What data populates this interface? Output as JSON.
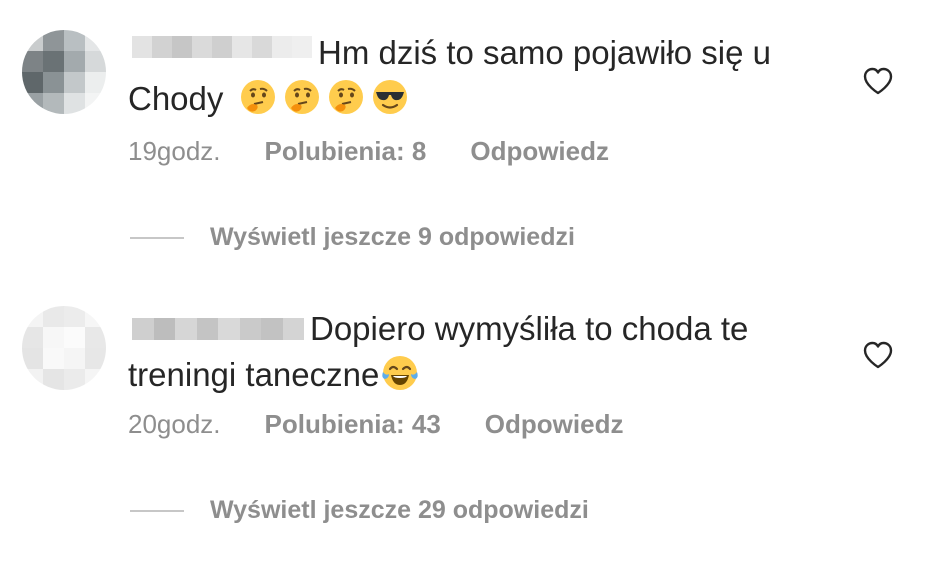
{
  "comments": [
    {
      "text_line1": "Hm dziś to samo pojawiło się u",
      "text_line2": "Chody",
      "emojis": [
        "thinking-face-emoji",
        "thinking-face-emoji",
        "thinking-face-emoji",
        "sunglasses-face-emoji"
      ],
      "time": "19godz.",
      "likes": "Polubienia: 8",
      "reply": "Odpowiedz",
      "view_replies": "Wyświetl jeszcze 9 odpowiedzi"
    },
    {
      "text_line1": "Dopiero wymyśliła to choda te",
      "text_line2": "treningi taneczne",
      "emojis": [
        "tears-of-joy-emoji"
      ],
      "time": "20godz.",
      "likes": "Polubienia: 43",
      "reply": "Odpowiedz",
      "view_replies": "Wyświetl jeszcze 29 odpowiedzi"
    }
  ],
  "icons": {
    "like": "heart-icon"
  },
  "colors": {
    "text": "#262626",
    "secondary": "#8e8e8e",
    "divider": "#c7c7c7"
  }
}
